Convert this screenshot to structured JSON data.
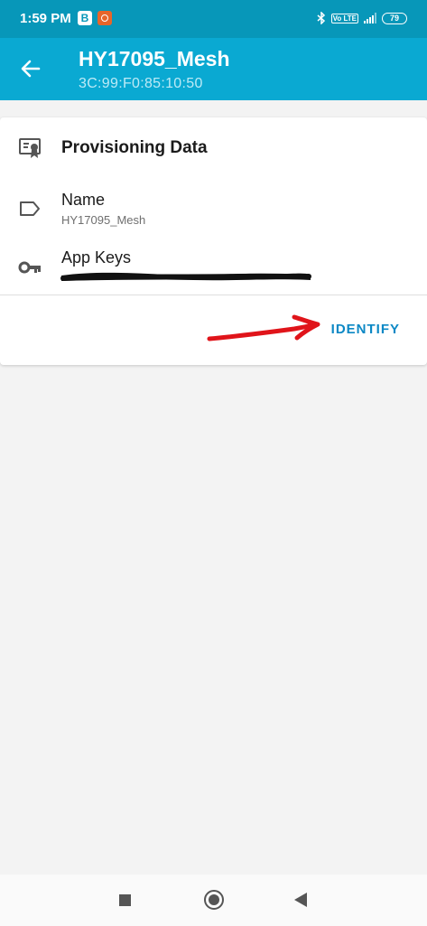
{
  "status_bar": {
    "time": "1:59 PM",
    "notification_b": "B",
    "volte": "Vo LTE",
    "battery": "79"
  },
  "app_bar": {
    "title": "HY17095_Mesh",
    "subtitle": "3C:99:F0:85:10:50",
    "back_icon": "arrow-left-icon"
  },
  "card": {
    "heading": "Provisioning Data",
    "heading_icon": "certificate-icon",
    "name_label": "Name",
    "name_value": "HY17095_Mesh",
    "name_icon": "label-tag-icon",
    "app_keys_label": "App Keys",
    "app_keys_icon": "key-icon",
    "identify_label": "IDENTIFY"
  },
  "colors": {
    "status_bar": "#0797b9",
    "app_bar": "#0aa9d2",
    "accent": "#0b88c5",
    "annotation_arrow": "#e0141a"
  },
  "nav_bar": {
    "recents_icon": "square-icon",
    "home_icon": "circle-icon",
    "back_icon": "triangle-back-icon"
  }
}
